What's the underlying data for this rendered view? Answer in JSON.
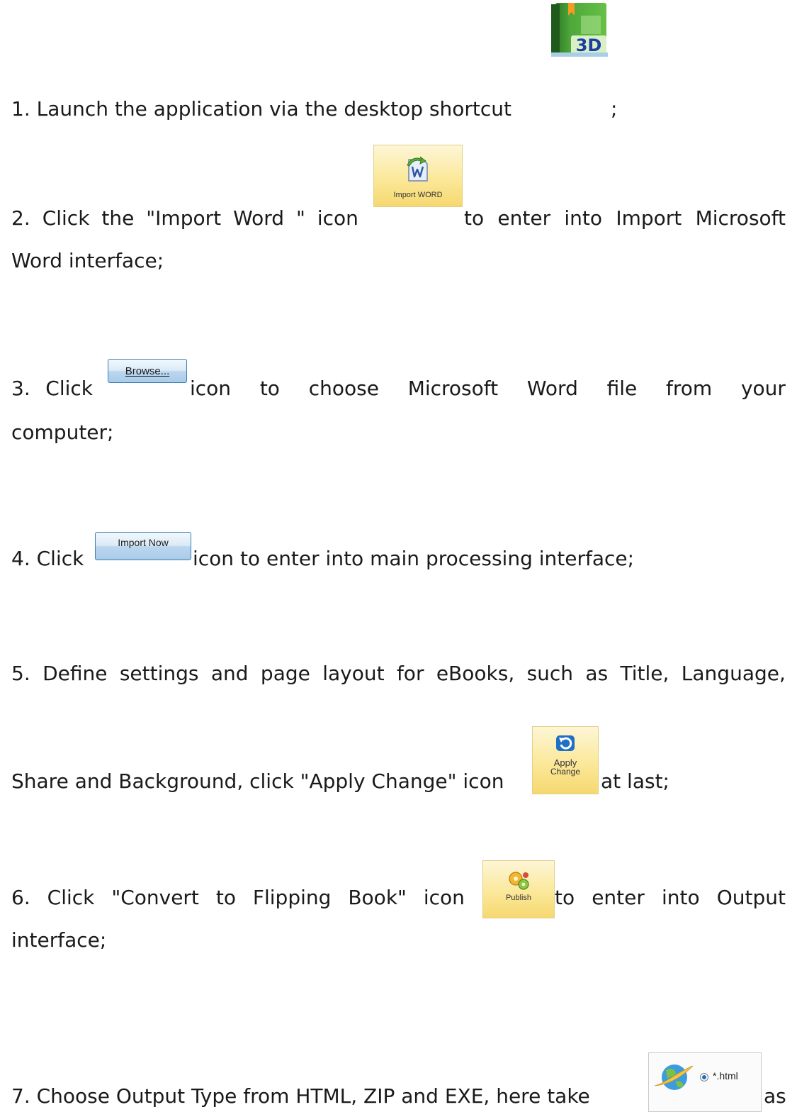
{
  "steps": [
    {
      "before": "1. Launch the application via the desktop shortcut",
      "after": ";"
    },
    {
      "words": [
        "2.",
        "Click",
        "the",
        "\"Import",
        "Word",
        "\"",
        "icon"
      ],
      "after_words": [
        "to",
        "enter",
        "into",
        "Import",
        "Microsoft"
      ],
      "continuation": "Word interface;"
    },
    {
      "words": [
        "3.",
        "Click"
      ],
      "after_words": [
        "icon",
        "to",
        "choose",
        "Microsoft",
        "Word",
        "file",
        "from",
        "your"
      ],
      "continuation": "computer;"
    },
    {
      "before": "4. Click",
      "after": "icon to enter into main processing interface;"
    },
    {
      "words": [
        "5.",
        "Define",
        "settings",
        "and",
        "page",
        "layout",
        "for",
        "eBooks,",
        "such",
        "as",
        "Title,",
        "Language,"
      ],
      "second_line_before": "Share and Background, click \"Apply Change\" icon",
      "after": "at last;"
    },
    {
      "words": [
        "6.",
        "Click",
        "\"Convert",
        "to",
        "Flipping",
        "Book\"",
        "icon"
      ],
      "after_words": [
        "to",
        "enter",
        "into",
        "Output"
      ],
      "continuation": "interface;"
    },
    {
      "before": "7. Choose Output Type from HTML, ZIP and EXE, here take",
      "after": "as"
    }
  ],
  "icons": {
    "app_shortcut": {
      "name": "3d-flipbook-app-icon",
      "text": "3D",
      "color": "#4aa82e"
    },
    "import_word": {
      "name": "import-word-icon",
      "caption": "Import WORD"
    },
    "browse_button": {
      "label": "Browse..."
    },
    "import_now_button": {
      "label": "Import Now"
    },
    "apply_change": {
      "name": "refresh-icon",
      "caption_1": "Apply",
      "caption_2": "Change"
    },
    "publish": {
      "name": "gears-icon",
      "caption": "Publish"
    },
    "output_type": {
      "name": "globe-icon",
      "radio_label": "*.html"
    }
  }
}
